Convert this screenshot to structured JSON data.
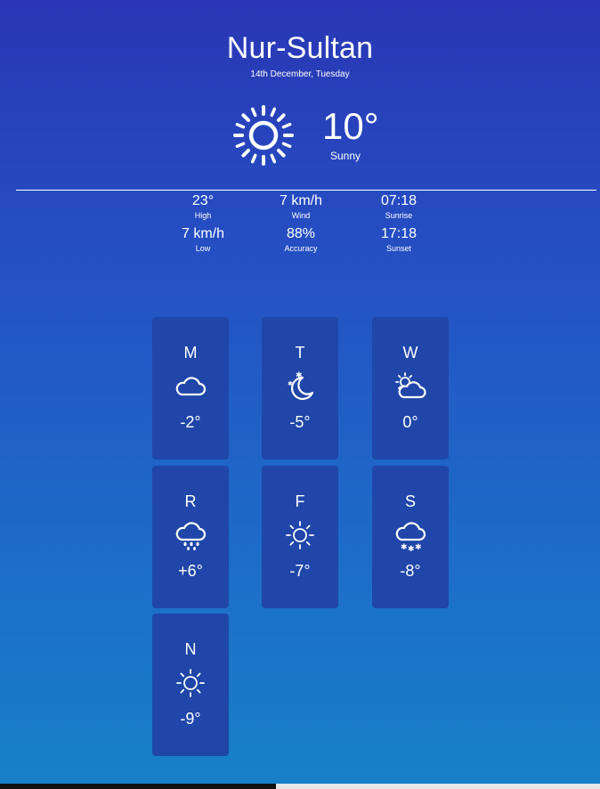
{
  "location": {
    "city": "Nur-Sultan",
    "date": "14th December, Tuesday"
  },
  "current": {
    "temperature": "10°",
    "condition": "Sunny",
    "icon": "sun-icon"
  },
  "stats": [
    {
      "value": "23°",
      "label": "High"
    },
    {
      "value": "7 km/h",
      "label": "Wind"
    },
    {
      "value": "07:18",
      "label": "Sunrise"
    },
    {
      "value": "7 km/h",
      "label": "Low"
    },
    {
      "value": "88%",
      "label": "Accuracy"
    },
    {
      "value": "17:18",
      "label": "Sunset"
    }
  ],
  "forecast": [
    {
      "day": "M",
      "icon": "cloud-icon",
      "temp": "-2°"
    },
    {
      "day": "T",
      "icon": "moon-stars-icon",
      "temp": "-5°"
    },
    {
      "day": "W",
      "icon": "sun-cloud-icon",
      "temp": "0°"
    },
    {
      "day": "R",
      "icon": "rain-cloud-icon",
      "temp": "+6°"
    },
    {
      "day": "F",
      "icon": "sun-icon",
      "temp": "-7°"
    },
    {
      "day": "S",
      "icon": "snow-cloud-icon",
      "temp": "-8°"
    },
    {
      "day": "N",
      "icon": "sun-icon",
      "temp": "-9°"
    }
  ],
  "colors": {
    "background_top": "#2a36b5",
    "background_bottom": "#1781c9",
    "card": "#1f46a8",
    "text": "#ffffff"
  }
}
